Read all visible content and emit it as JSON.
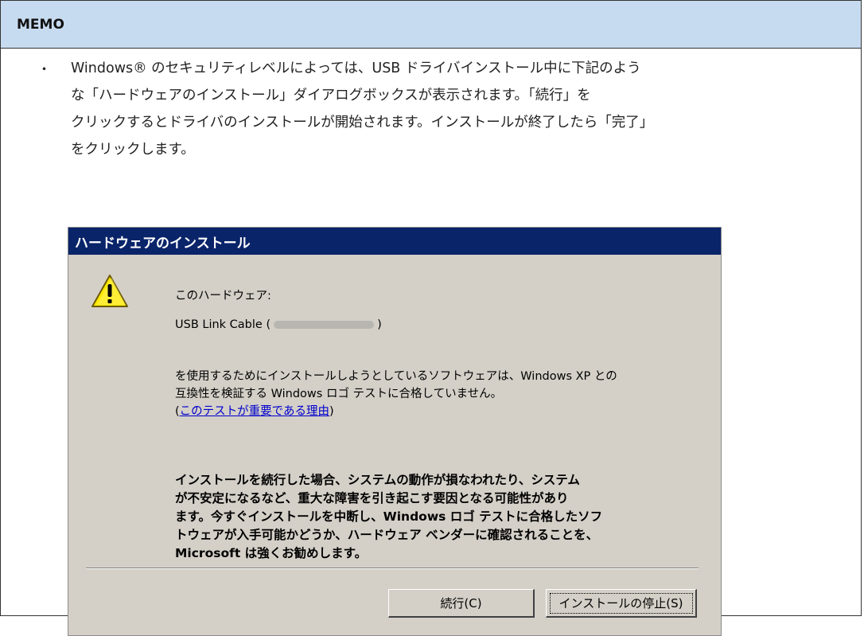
{
  "memo": {
    "header": "MEMO",
    "bullet": "・",
    "lines": [
      "Windows® のセキュリティレベルによっては、USB ドライバインストール中に下記のよう",
      "な「ハードウェアのインストール」ダイアログボックスが表示されます。「続行」を",
      "クリックするとドライバのインストールが開始されます。インストールが終了したら「完了」",
      "をクリックします。"
    ]
  },
  "dialog": {
    "title": "ハードウェアのインストール",
    "icon": "warning-icon",
    "hardware_label": "このハードウェア:",
    "device_prefix": "USB Link Cable (",
    "device_suffix": ")",
    "message_lines": [
      "を使用するためにインストールしようとしているソフトウェアは、Windows XP との",
      "互換性を検証する Windows ロゴ テストに合格していません。"
    ],
    "link_open": "(",
    "link_text": "このテストが重要である理由",
    "link_close": ")",
    "warning_lines": [
      "インストールを続行した場合、システムの動作が損なわれたり、システム",
      "が不安定になるなど、重大な障害を引き起こす要因となる可能性があり",
      "ます。今すぐインストールを中断し、Windows ロゴ テストに合格したソフ",
      "トウェアが入手可能かどうか、ハードウェア ベンダーに確認されることを、",
      "Microsoft は強くお勧めします。"
    ],
    "continue_button": "続行(C)",
    "stop_button": "インストールの停止(S)"
  },
  "colors": {
    "header_bg": "#c7dbf0",
    "titlebar_bg": "#0a246a",
    "dialog_bg": "#d4d0c8",
    "link": "#0000cc"
  }
}
